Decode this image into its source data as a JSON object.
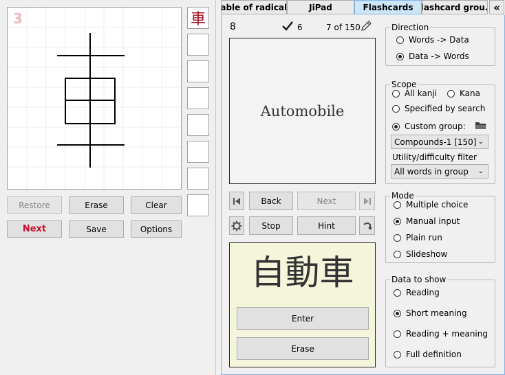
{
  "left": {
    "stroke_count": "3",
    "candidate_kanji": "車",
    "buttons": {
      "restore": "Restore",
      "erase": "Erase",
      "clear": "Clear",
      "next": "Next",
      "save": "Save",
      "options": "Options"
    }
  },
  "tabs": [
    "Table of radicals",
    "JiPad",
    "Flashcards",
    "Flashcard grou..."
  ],
  "tab_collapse_glyph": "«",
  "card": {
    "number": "8",
    "correct_count": "6",
    "position": "7 of 150",
    "prompt": "Automobile",
    "answer_kanji": "自動車"
  },
  "controls": {
    "back": "Back",
    "next": "Next",
    "stop": "Stop",
    "hint": "Hint",
    "enter": "Enter",
    "erase": "Erase"
  },
  "direction": {
    "title": "Direction",
    "options": [
      "Words -> Data",
      "Data -> Words"
    ],
    "selected": 1
  },
  "scope": {
    "title": "Scope",
    "all_kanji": "All kanji",
    "kana": "Kana",
    "specified": "Specified by search",
    "custom_group": "Custom group:",
    "group_value": "Compounds-1 [150]",
    "filter_label": "Utility/difficulty filter",
    "filter_value": "All words in group"
  },
  "mode": {
    "title": "Mode",
    "options": [
      "Multiple choice",
      "Manual input",
      "Plain run",
      "Slideshow"
    ],
    "selected": 1
  },
  "data_to_show": {
    "title": "Data to show",
    "options": [
      "Reading",
      "Short meaning",
      "Reading + meaning",
      "Full definition"
    ],
    "selected": 1
  },
  "colors": {
    "accent_red": "#c8102e",
    "stroke_num": "#f2b8bf",
    "tab_active": "#cde6f7",
    "answer_bg": "#f5f5dc"
  }
}
